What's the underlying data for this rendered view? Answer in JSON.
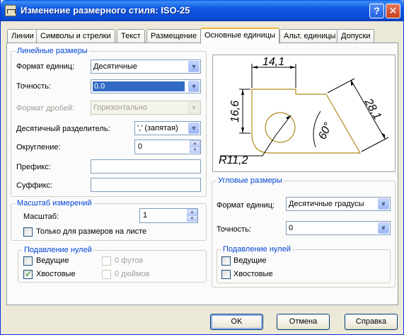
{
  "window": {
    "title": "Изменение размерного стиля: ISO-25"
  },
  "tabs": [
    "Линии",
    "Символы и стрелки",
    "Текст",
    "Размещение",
    "Основные единицы",
    "Альт. единицы",
    "Допуски"
  ],
  "active_tab": "Основные единицы",
  "linear": {
    "legend": "Линейные размеры",
    "unit_format": {
      "label": "Формат единиц:",
      "value": "Десятичные"
    },
    "precision": {
      "label": "Точность:",
      "value": "0.0"
    },
    "fraction_format": {
      "label": "Формат дробей:",
      "value": "Горизонтально"
    },
    "decimal_separator": {
      "label": "Десятичный  разделитель:",
      "value": "',' (запятая)"
    },
    "round_off": {
      "label": "Округление:",
      "value": "0"
    },
    "prefix": {
      "label": "Префикс:",
      "value": ""
    },
    "suffix": {
      "label": "Суффикс:",
      "value": ""
    }
  },
  "scale": {
    "legend": "Масштаб измерений",
    "factor": {
      "label": "Масштаб:",
      "value": "1"
    },
    "layout_only": {
      "label": "Только для размеров на листе",
      "checked": false
    }
  },
  "zero_linear": {
    "legend": "Подавление нулей",
    "leading": {
      "label": "Ведущие",
      "checked": false
    },
    "trailing": {
      "label": "Хвостовые",
      "checked": true
    },
    "feet": {
      "label": "0 футов",
      "checked": false,
      "disabled": true
    },
    "inches": {
      "label": "0 дюймов",
      "checked": false,
      "disabled": true
    }
  },
  "preview": {
    "dim_top": "14,1",
    "dim_left": "16,6",
    "dim_diag": "28,1",
    "angle": "60°",
    "radius": "R11,2"
  },
  "angular": {
    "legend": "Угловые размеры",
    "unit_format": {
      "label": "Формат единиц:",
      "value": "Десятичные градусы"
    },
    "precision": {
      "label": "Точность:",
      "value": "0"
    }
  },
  "zero_angular": {
    "legend": "Подавление нулей",
    "leading": {
      "label": "Ведущие",
      "checked": false
    },
    "trailing": {
      "label": "Хвостовые",
      "checked": false
    }
  },
  "buttons": {
    "ok": "OK",
    "cancel": "Отмена",
    "help": "Справка"
  }
}
